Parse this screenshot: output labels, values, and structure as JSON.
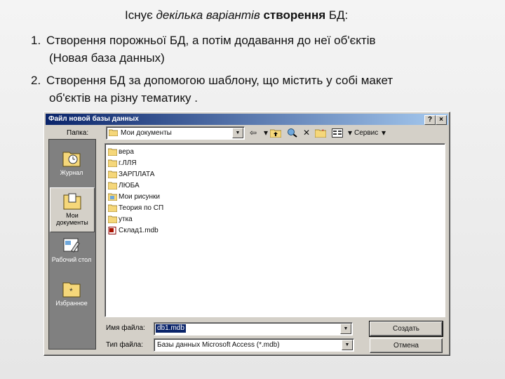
{
  "slide": {
    "line0": {
      "a": "Існує ",
      "b": "декілька варіантів",
      "c": " створення",
      "d": " БД:"
    },
    "item1": {
      "num": "1.",
      "text": "Створення порожньої БД, а потім додавання до неї об'єктів",
      "cont": "(Новая база данных)"
    },
    "item2": {
      "num": "2.",
      "text": "Створення БД за допомогою шаблону, що містить у собі макет",
      "cont": "об'єктів на різну тематику ."
    }
  },
  "dialog": {
    "title": "Файл новой базы данных",
    "help_btn": "?",
    "close_btn": "×",
    "folder_label": "Папка:",
    "folder_value": "Мои документы",
    "tools_label": "Сервис",
    "places": [
      {
        "label": "Журнал"
      },
      {
        "label": "Мои документы"
      },
      {
        "label": "Рабочий стол"
      },
      {
        "label": "Избранное"
      }
    ],
    "files": [
      {
        "name": "вера",
        "icon": "folder-icon"
      },
      {
        "name": "г.ЛЛЯ",
        "icon": "folder-icon"
      },
      {
        "name": "ЗАРПЛАТА",
        "icon": "folder-icon"
      },
      {
        "name": "ЛЮБА",
        "icon": "folder-icon"
      },
      {
        "name": "Мои рисунки",
        "icon": "pictures-folder-icon"
      },
      {
        "name": "Теория по СП",
        "icon": "folder-icon"
      },
      {
        "name": "утка",
        "icon": "folder-icon"
      },
      {
        "name": "Склад1.mdb",
        "icon": "access-file-icon"
      }
    ],
    "filename_label": "Имя файла:",
    "filename_value": "db1.mdb",
    "filetype_label": "Тип файла:",
    "filetype_value": "Базы данных Microsoft Access (*.mdb)",
    "create_btn": "Создать",
    "cancel_btn": "Отмена"
  }
}
